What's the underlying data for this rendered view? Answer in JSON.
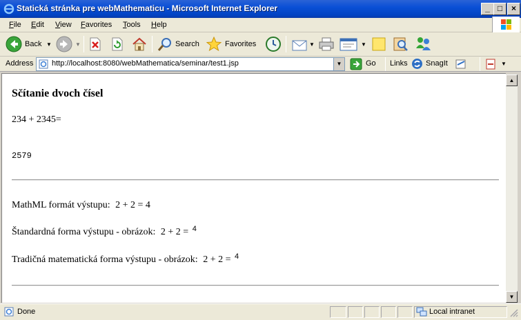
{
  "window": {
    "title": "Statická stránka pre webMathematicu - Microsoft Internet Explorer",
    "controls": {
      "minimize": "_",
      "maximize": "□",
      "close": "×"
    }
  },
  "menu": {
    "items": [
      {
        "label": "File"
      },
      {
        "label": "Edit"
      },
      {
        "label": "View"
      },
      {
        "label": "Favorites"
      },
      {
        "label": "Tools"
      },
      {
        "label": "Help"
      }
    ]
  },
  "toolbar": {
    "back_label": "Back",
    "search_label": "Search",
    "favorites_label": "Favorites",
    "icons": [
      "back-icon",
      "forward-icon",
      "stop-icon",
      "refresh-icon",
      "home-icon",
      "search-icon",
      "favorites-star-icon",
      "history-icon",
      "mail-icon",
      "print-icon",
      "edit-icon",
      "note-icon",
      "research-icon",
      "messenger-icon"
    ]
  },
  "address": {
    "label": "Address",
    "url": "http://localhost:8080/webMathematica/seminar/test1.jsp",
    "go_label": "Go",
    "links_label": "Links",
    "snagit_label": "SnagIt"
  },
  "page": {
    "heading": "Sčítanie dvoch čísel",
    "expression": "234 + 2345=",
    "result": "2579",
    "mathml": {
      "label": "MathML formát výstupu:",
      "expr": "2 + 2 = 4"
    },
    "standard": {
      "label": "Štandardná forma výstupu - obrázok:",
      "expr": "2 + 2 =",
      "value": "4"
    },
    "traditional": {
      "label": "Tradičná matematická forma výstupu - obrázok:",
      "expr": "2 + 2 =",
      "value": "4"
    }
  },
  "status": {
    "text": "Done",
    "zone": "Local intranet"
  },
  "colors": {
    "titlebar": "#0a4fd6",
    "chrome": "#ece9d8",
    "content_bg": "#ffffff"
  }
}
